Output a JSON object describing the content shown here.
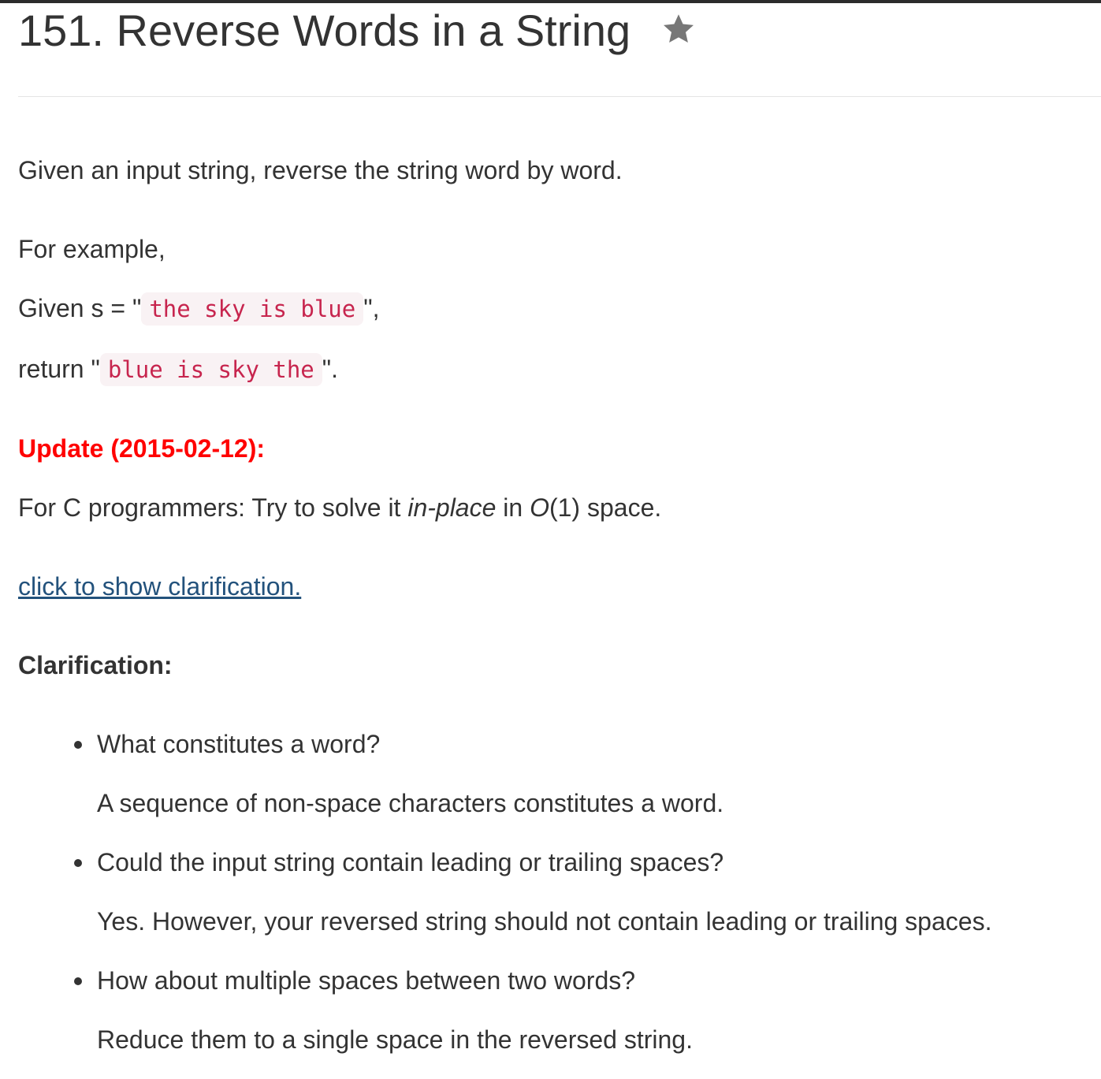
{
  "problem": {
    "title": "151. Reverse Words in a String",
    "star_icon": "star-icon"
  },
  "description": {
    "intro": "Given an input string, reverse the string word by word.",
    "example_heading": "For example,",
    "given_prefix": "Given s = \"",
    "given_code": "the sky is blue",
    "given_suffix": "\",",
    "return_prefix": "return \"",
    "return_code": "blue is sky the",
    "return_suffix": "\"."
  },
  "update": {
    "label": "Update (2015-02-12):",
    "text_prefix": "For C programmers: Try to solve it ",
    "text_em1": "in-place",
    "text_mid": " in ",
    "text_em2": "O",
    "text_suffix": "(1) space."
  },
  "clarification": {
    "link_text": "click to show clarification.",
    "heading": "Clarification:",
    "items": [
      {
        "question": "What constitutes a word?",
        "answer": "A sequence of non-space characters constitutes a word."
      },
      {
        "question": "Could the input string contain leading or trailing spaces?",
        "answer": "Yes. However, your reversed string should not contain leading or trailing spaces."
      },
      {
        "question": "How about multiple spaces between two words?",
        "answer": "Reduce them to a single space in the reversed string."
      }
    ]
  },
  "colors": {
    "text": "#333333",
    "update_red": "#ff0000",
    "link_blue": "#23527c",
    "code_fg": "#c7254e",
    "code_bg": "#f9f2f4",
    "star_gray": "#777777"
  }
}
